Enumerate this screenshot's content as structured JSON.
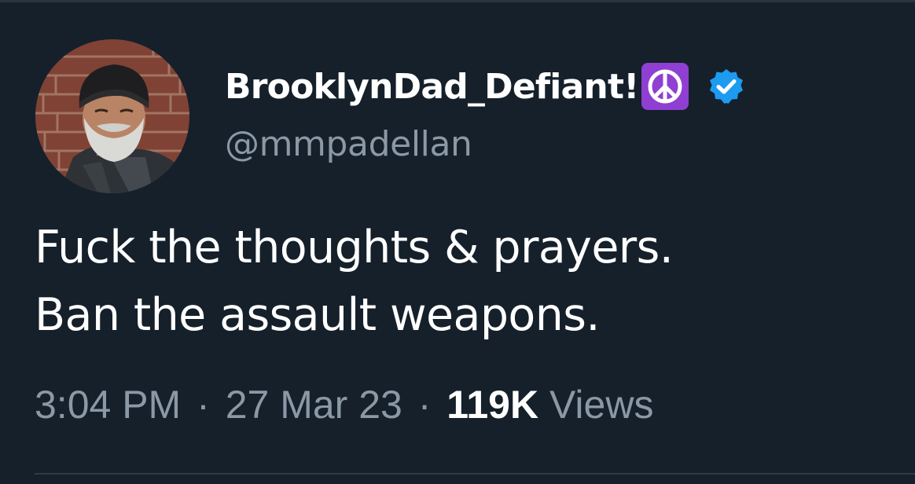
{
  "tweet": {
    "author": {
      "display_name": "BrooklynDad_Defiant!",
      "name_emoji": "peace-symbol-icon",
      "verified": true,
      "handle": "@mmpadellan"
    },
    "text_lines": [
      "Fuck the thoughts & prayers.",
      "Ban the assault weapons."
    ],
    "meta": {
      "time": "3:04 PM",
      "separator": "·",
      "date": "27 Mar 23",
      "views_count": "119K",
      "views_label": "Views"
    }
  },
  "colors": {
    "background": "#15202b",
    "text_primary": "#ffffff",
    "text_secondary": "#8b98a5",
    "verified_blue": "#1d9bf0",
    "emoji_purple": "#8f3fd1"
  }
}
